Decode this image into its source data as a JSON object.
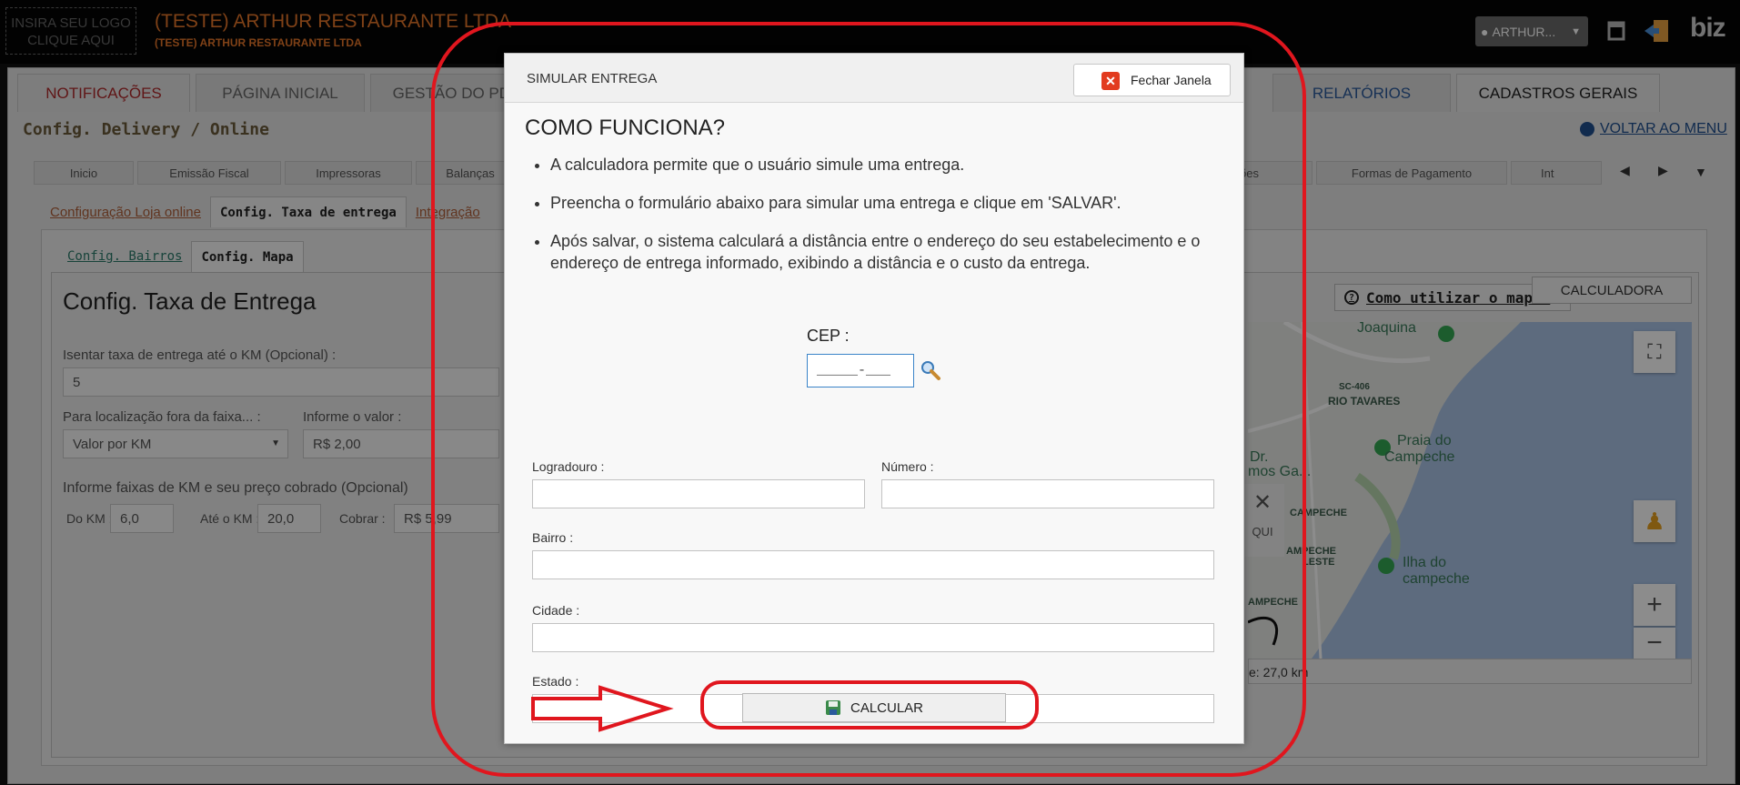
{
  "topbar": {
    "logo_line1": "INSIRA SEU LOGO",
    "logo_line2": "CLIQUE AQUI",
    "company_name": "(TESTE) ARTHUR RESTAURANTE LTDA",
    "company_subtitle": "(TESTE) ARTHUR RESTAURANTE LTDA",
    "user_label": "ARTHUR...",
    "brand": "biz"
  },
  "nav": {
    "tabs": [
      "NOTIFICAÇÕES",
      "PÁGINA INICIAL",
      "GESTÃO DO PDV",
      "RELATÓRIOS",
      "CADASTROS GERAIS"
    ]
  },
  "page": {
    "title": "Config. Delivery / Online",
    "back_link": "VOLTAR AO MENU",
    "subtabs": [
      "Inicio",
      "Emissão Fiscal",
      "Impressoras",
      "Balanças",
      "elivery Opções",
      "Formas de Pagamento",
      "Int"
    ],
    "config_tabs": [
      "Configuração Loja online",
      "Config. Taxa de entrega",
      "Integração"
    ],
    "bairro_tabs": [
      "Config. Bairros",
      "Config. Mapa"
    ]
  },
  "taxa": {
    "title": "Config. Taxa de Entrega",
    "isentar_label": "Isentar taxa de entrega até o KM (Opcional) :",
    "isentar_value": "5",
    "fora_label": "Para localização fora da faixa... :",
    "fora_value": "Valor por KM",
    "informe_label": "Informe o valor :",
    "informe_value": "R$ 2,00",
    "faixas_label": "Informe faixas de KM e seu preço cobrado (Opcional)",
    "do_km_label": "Do KM :",
    "do_km_value": "6,0",
    "ate_km_label": "Até o KM :",
    "ate_km_value": "20,0",
    "cobrar_label": "Cobrar :",
    "cobrar_value": "R$ 5,99",
    "help_link": "Como utilizar o mapa?",
    "calc_bg_button": "CALCULADORA"
  },
  "map": {
    "labels": [
      "Joaquina",
      "SC-406",
      "RIO TAVARES",
      "Praia do",
      "Campeche",
      "Ilha do",
      "campeche",
      "CAMPECHE",
      "AMPECHE",
      "LESTE",
      "AMPECHE",
      "Dr.",
      "mos Ga..."
    ],
    "close_text": "QUI",
    "distance_text": "e: 27,0 km"
  },
  "modal": {
    "title": "SIMULAR ENTREGA",
    "close_label": "Fechar Janela",
    "how_title": "COMO FUNCIONA?",
    "bullets": [
      "A calculadora permite que o usuário simule uma entrega.",
      "Preencha o formulário abaixo para simular uma entrega e clique em 'SALVAR'.",
      "Após salvar, o sistema calculará a distância entre o endereço do seu estabelecimento e o endereço de entrega informado, exibindo a distância e o custo da entrega."
    ],
    "cep_label": "CEP :",
    "cep_value": "_____-___",
    "logradouro_label": "Logradouro :",
    "numero_label": "Número :",
    "bairro_label": "Bairro :",
    "cidade_label": "Cidade :",
    "estado_label": "Estado :",
    "calc_label": "CALCULAR"
  },
  "colors": {
    "accent_orange": "#e8772a",
    "annotation_red": "#e0161e",
    "link_blue": "#1f4f8f",
    "close_red": "#e23b1f"
  }
}
